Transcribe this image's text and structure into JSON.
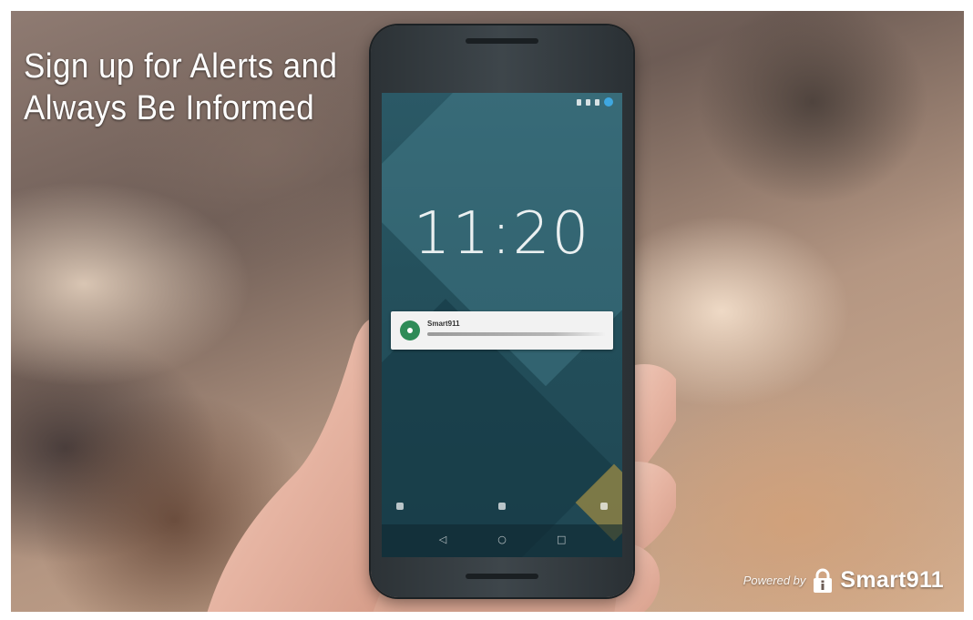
{
  "banner": {
    "headline": "Sign up for Alerts and Always Be Informed",
    "powered_by": "Powered by",
    "brand": "Smart911"
  },
  "phone": {
    "clock": "11:20",
    "notification": {
      "app_name": "Smart911"
    }
  },
  "icons": {
    "brand_logo": "padlock-info-icon",
    "notification": "smart911-app-icon",
    "nav": [
      "back-triangle-icon",
      "home-circle-icon",
      "recents-square-icon"
    ]
  },
  "colors": {
    "text": "#ffffff",
    "notification_icon": "#2e8b57",
    "screen": "#24505c"
  }
}
